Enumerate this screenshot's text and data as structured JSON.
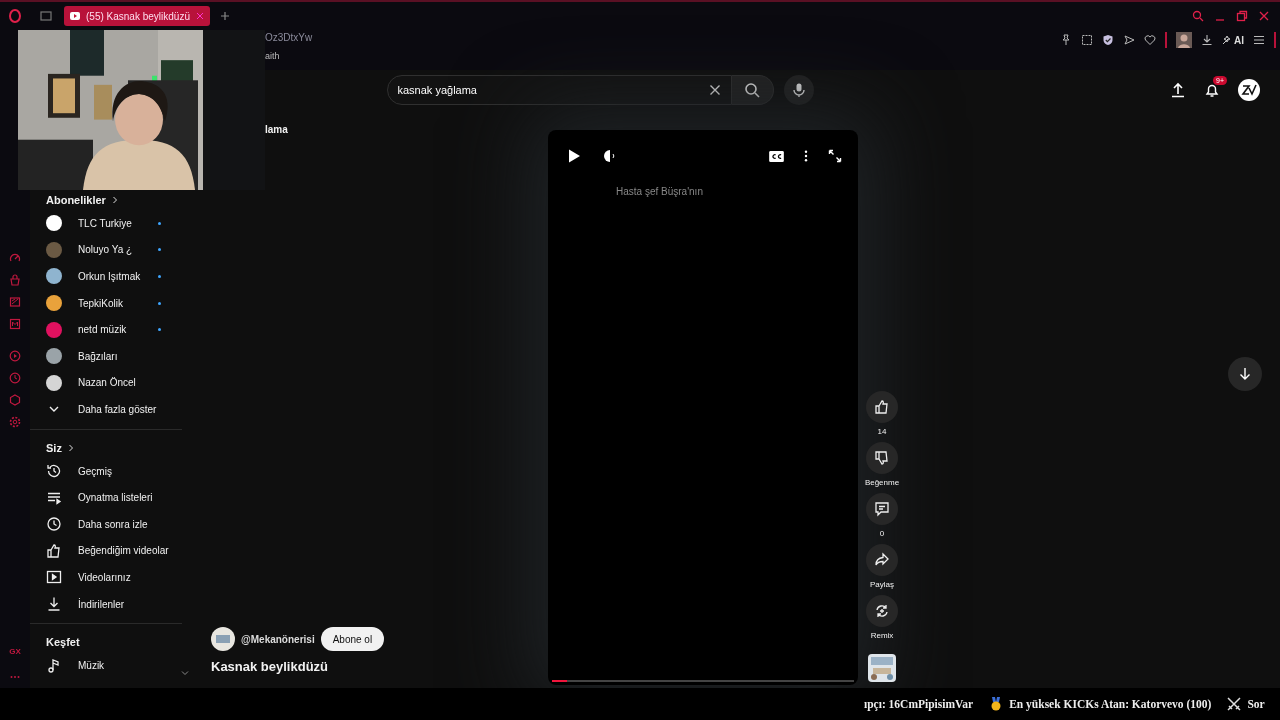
{
  "browser": {
    "tab_title": "(55) Kasnak beylikdüzü",
    "address_fragment": "Oz3DtxYw",
    "bookmark_fragment": "aith",
    "gx_label": "GX"
  },
  "toolbar": {
    "ai_label": "AI"
  },
  "youtube": {
    "search": {
      "value": "kasnak yağlama"
    },
    "notification_count": "9+",
    "sidebar": {
      "subscriptions_title": "Abonelikler",
      "channels": [
        {
          "name": "TLC Turkiye",
          "color": "#ffffff",
          "new_content": true
        },
        {
          "name": "Noluyo Ya ¿",
          "color": "#6b5a44",
          "new_content": true
        },
        {
          "name": "Orkun Işıtmak",
          "color": "#8fb4cf",
          "new_content": true
        },
        {
          "name": "TepkiKolik",
          "color": "#e9a23b",
          "new_content": true
        },
        {
          "name": "netd müzik",
          "color": "#e0115f",
          "new_content": true
        },
        {
          "name": "Bağzıları",
          "color": "#9aa3a8",
          "new_content": false
        },
        {
          "name": "Nazan Öncel",
          "color": "#d5d5d5",
          "new_content": false
        }
      ],
      "show_more": "Daha fazla göster",
      "you_title": "Siz",
      "you_items": [
        {
          "kind": "history",
          "label": "Geçmiş"
        },
        {
          "kind": "playlist",
          "label": "Oynatma listeleri"
        },
        {
          "kind": "clock",
          "label": "Daha sonra izle"
        },
        {
          "kind": "like",
          "label": "Beğendiğim videolar"
        },
        {
          "kind": "video",
          "label": "Videolarınız"
        },
        {
          "kind": "download",
          "label": "İndirilenler"
        }
      ],
      "explore_title": "Keşfet",
      "explore_items": [
        {
          "kind": "music",
          "label": "Müzik"
        }
      ]
    },
    "section_fragment": "lama",
    "short": {
      "caption": "Hasta şef Büşra'nın",
      "level": 0.05,
      "channel": "@Mekanönerisi",
      "subscribe": "Abone ol",
      "title": "Kasnak beylikdüzü",
      "actions": [
        {
          "kind": "like",
          "label": "14"
        },
        {
          "kind": "dislike",
          "label": "Beğenme"
        },
        {
          "kind": "comment",
          "label": "0"
        },
        {
          "kind": "share",
          "label": "Paylaş"
        },
        {
          "kind": "remix",
          "label": "Remix"
        }
      ]
    }
  },
  "ticker": [
    {
      "kind": "plain",
      "text": "ıpçı: 16CmPipisimVar"
    },
    {
      "kind": "medal",
      "text": "En yüksek KICKs Atan: Katorvevo (100)"
    },
    {
      "kind": "swords",
      "text": "Sor"
    }
  ]
}
